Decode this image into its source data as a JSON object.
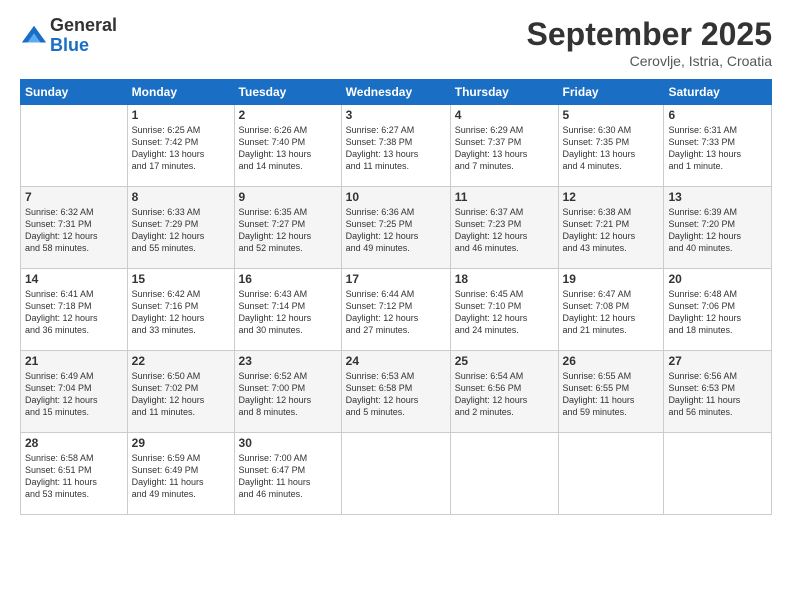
{
  "header": {
    "logo_general": "General",
    "logo_blue": "Blue",
    "month_title": "September 2025",
    "location": "Cerovlje, Istria, Croatia"
  },
  "days_of_week": [
    "Sunday",
    "Monday",
    "Tuesday",
    "Wednesday",
    "Thursday",
    "Friday",
    "Saturday"
  ],
  "weeks": [
    [
      {
        "day": "",
        "info": ""
      },
      {
        "day": "1",
        "info": "Sunrise: 6:25 AM\nSunset: 7:42 PM\nDaylight: 13 hours\nand 17 minutes."
      },
      {
        "day": "2",
        "info": "Sunrise: 6:26 AM\nSunset: 7:40 PM\nDaylight: 13 hours\nand 14 minutes."
      },
      {
        "day": "3",
        "info": "Sunrise: 6:27 AM\nSunset: 7:38 PM\nDaylight: 13 hours\nand 11 minutes."
      },
      {
        "day": "4",
        "info": "Sunrise: 6:29 AM\nSunset: 7:37 PM\nDaylight: 13 hours\nand 7 minutes."
      },
      {
        "day": "5",
        "info": "Sunrise: 6:30 AM\nSunset: 7:35 PM\nDaylight: 13 hours\nand 4 minutes."
      },
      {
        "day": "6",
        "info": "Sunrise: 6:31 AM\nSunset: 7:33 PM\nDaylight: 13 hours\nand 1 minute."
      }
    ],
    [
      {
        "day": "7",
        "info": "Sunrise: 6:32 AM\nSunset: 7:31 PM\nDaylight: 12 hours\nand 58 minutes."
      },
      {
        "day": "8",
        "info": "Sunrise: 6:33 AM\nSunset: 7:29 PM\nDaylight: 12 hours\nand 55 minutes."
      },
      {
        "day": "9",
        "info": "Sunrise: 6:35 AM\nSunset: 7:27 PM\nDaylight: 12 hours\nand 52 minutes."
      },
      {
        "day": "10",
        "info": "Sunrise: 6:36 AM\nSunset: 7:25 PM\nDaylight: 12 hours\nand 49 minutes."
      },
      {
        "day": "11",
        "info": "Sunrise: 6:37 AM\nSunset: 7:23 PM\nDaylight: 12 hours\nand 46 minutes."
      },
      {
        "day": "12",
        "info": "Sunrise: 6:38 AM\nSunset: 7:21 PM\nDaylight: 12 hours\nand 43 minutes."
      },
      {
        "day": "13",
        "info": "Sunrise: 6:39 AM\nSunset: 7:20 PM\nDaylight: 12 hours\nand 40 minutes."
      }
    ],
    [
      {
        "day": "14",
        "info": "Sunrise: 6:41 AM\nSunset: 7:18 PM\nDaylight: 12 hours\nand 36 minutes."
      },
      {
        "day": "15",
        "info": "Sunrise: 6:42 AM\nSunset: 7:16 PM\nDaylight: 12 hours\nand 33 minutes."
      },
      {
        "day": "16",
        "info": "Sunrise: 6:43 AM\nSunset: 7:14 PM\nDaylight: 12 hours\nand 30 minutes."
      },
      {
        "day": "17",
        "info": "Sunrise: 6:44 AM\nSunset: 7:12 PM\nDaylight: 12 hours\nand 27 minutes."
      },
      {
        "day": "18",
        "info": "Sunrise: 6:45 AM\nSunset: 7:10 PM\nDaylight: 12 hours\nand 24 minutes."
      },
      {
        "day": "19",
        "info": "Sunrise: 6:47 AM\nSunset: 7:08 PM\nDaylight: 12 hours\nand 21 minutes."
      },
      {
        "day": "20",
        "info": "Sunrise: 6:48 AM\nSunset: 7:06 PM\nDaylight: 12 hours\nand 18 minutes."
      }
    ],
    [
      {
        "day": "21",
        "info": "Sunrise: 6:49 AM\nSunset: 7:04 PM\nDaylight: 12 hours\nand 15 minutes."
      },
      {
        "day": "22",
        "info": "Sunrise: 6:50 AM\nSunset: 7:02 PM\nDaylight: 12 hours\nand 11 minutes."
      },
      {
        "day": "23",
        "info": "Sunrise: 6:52 AM\nSunset: 7:00 PM\nDaylight: 12 hours\nand 8 minutes."
      },
      {
        "day": "24",
        "info": "Sunrise: 6:53 AM\nSunset: 6:58 PM\nDaylight: 12 hours\nand 5 minutes."
      },
      {
        "day": "25",
        "info": "Sunrise: 6:54 AM\nSunset: 6:56 PM\nDaylight: 12 hours\nand 2 minutes."
      },
      {
        "day": "26",
        "info": "Sunrise: 6:55 AM\nSunset: 6:55 PM\nDaylight: 11 hours\nand 59 minutes."
      },
      {
        "day": "27",
        "info": "Sunrise: 6:56 AM\nSunset: 6:53 PM\nDaylight: 11 hours\nand 56 minutes."
      }
    ],
    [
      {
        "day": "28",
        "info": "Sunrise: 6:58 AM\nSunset: 6:51 PM\nDaylight: 11 hours\nand 53 minutes."
      },
      {
        "day": "29",
        "info": "Sunrise: 6:59 AM\nSunset: 6:49 PM\nDaylight: 11 hours\nand 49 minutes."
      },
      {
        "day": "30",
        "info": "Sunrise: 7:00 AM\nSunset: 6:47 PM\nDaylight: 11 hours\nand 46 minutes."
      },
      {
        "day": "",
        "info": ""
      },
      {
        "day": "",
        "info": ""
      },
      {
        "day": "",
        "info": ""
      },
      {
        "day": "",
        "info": ""
      }
    ]
  ]
}
